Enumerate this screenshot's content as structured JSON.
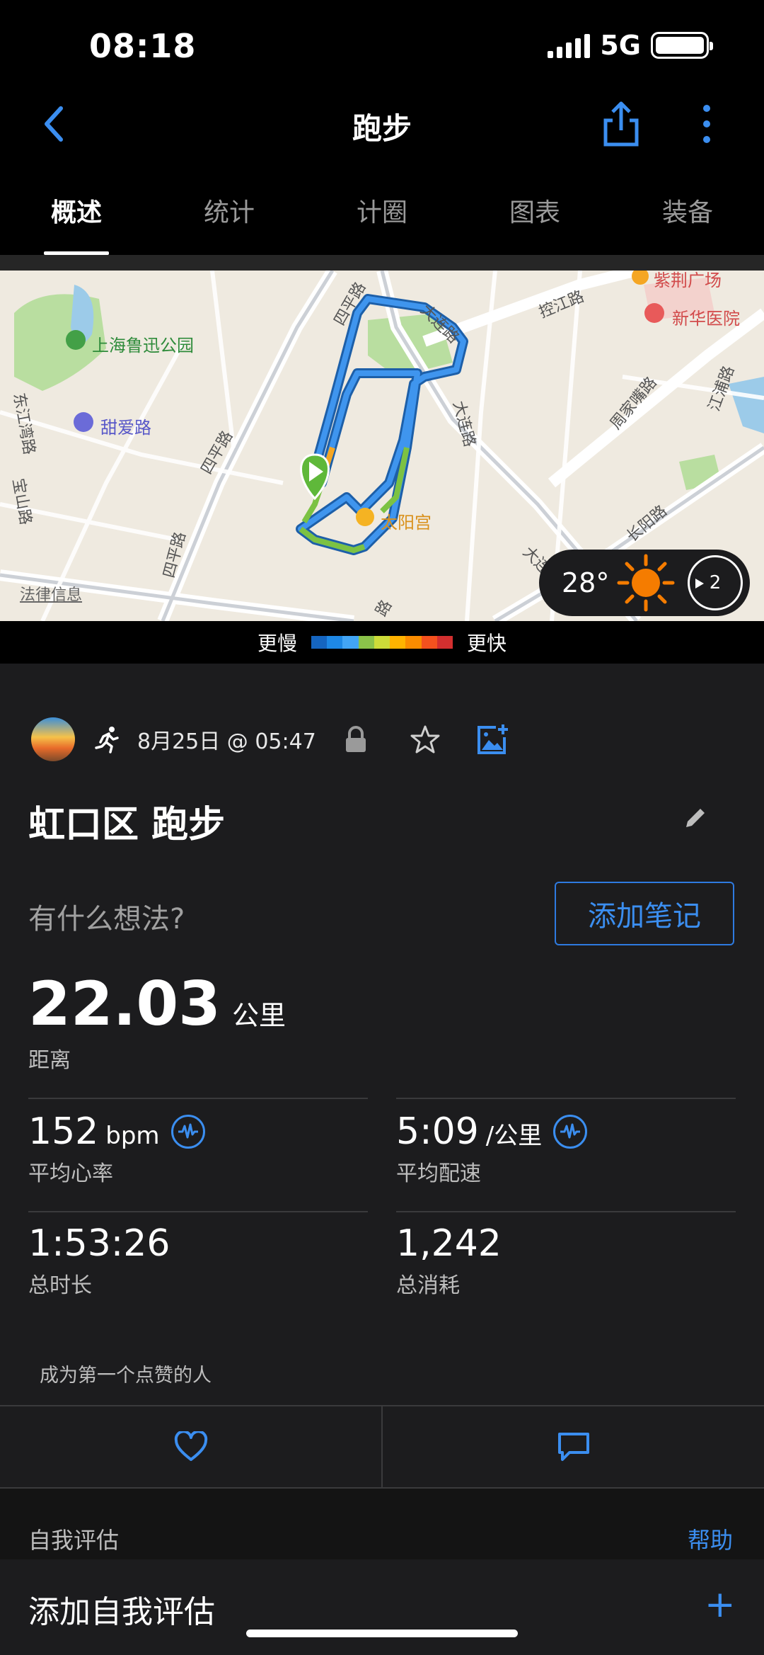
{
  "status_bar": {
    "time": "08:18",
    "network": "5G"
  },
  "header": {
    "title": "跑步"
  },
  "tabs": [
    {
      "label": "概述",
      "active": true
    },
    {
      "label": "统计",
      "active": false
    },
    {
      "label": "计圈",
      "active": false
    },
    {
      "label": "图表",
      "active": false
    },
    {
      "label": "装备",
      "active": false
    }
  ],
  "map": {
    "labels": {
      "park": "上海鲁迅公园",
      "tianai": "甜爱路",
      "hospital": "新华医院",
      "zijing": "紫荆广场",
      "taiyang": "太阳宫",
      "dalian1": "大连路",
      "dalian2": "大连路",
      "dalian3": "大连",
      "kongjiang": "控江路",
      "siping1": "四平路",
      "siping2": "四平路",
      "siping3": "四平路",
      "zhoujiazui": "周家嘴路",
      "jiangpu": "江浦路",
      "changyang": "长阳路",
      "dongjiangwan": "东江湾路",
      "baoshan": "宝山路",
      "road_bottom": "路",
      "legal": "法律信息"
    },
    "weather": {
      "temperature": "28°",
      "wind_force": "2"
    }
  },
  "legend": {
    "slower": "更慢",
    "faster": "更快",
    "colors": [
      "#1565c0",
      "#1e88e5",
      "#42a5f5",
      "#8bc34a",
      "#cddc39",
      "#ffb300",
      "#fb8c00",
      "#f4511e",
      "#d32f2f"
    ]
  },
  "activity": {
    "date": "8月25日 @ 05:47",
    "title": "虹口区 跑步",
    "thoughts_prompt": "有什么想法?",
    "add_note": "添加笔记"
  },
  "stats": {
    "distance": {
      "value": "22.03",
      "unit": "公里",
      "label": "距离"
    },
    "avg_hr": {
      "value": "152",
      "unit": "bpm",
      "label": "平均心率"
    },
    "avg_pace": {
      "value": "5:09",
      "unit": "/公里",
      "label": "平均配速"
    },
    "duration": {
      "value": "1:53:26",
      "label": "总时长"
    },
    "calories": {
      "value": "1,242",
      "label": "总消耗"
    }
  },
  "social": {
    "first_like": "成为第一个点赞的人"
  },
  "self_eval": {
    "section": "自我评估",
    "help": "帮助",
    "add": "添加自我评估",
    "plus": "+"
  },
  "accent": "#3b8ef0"
}
